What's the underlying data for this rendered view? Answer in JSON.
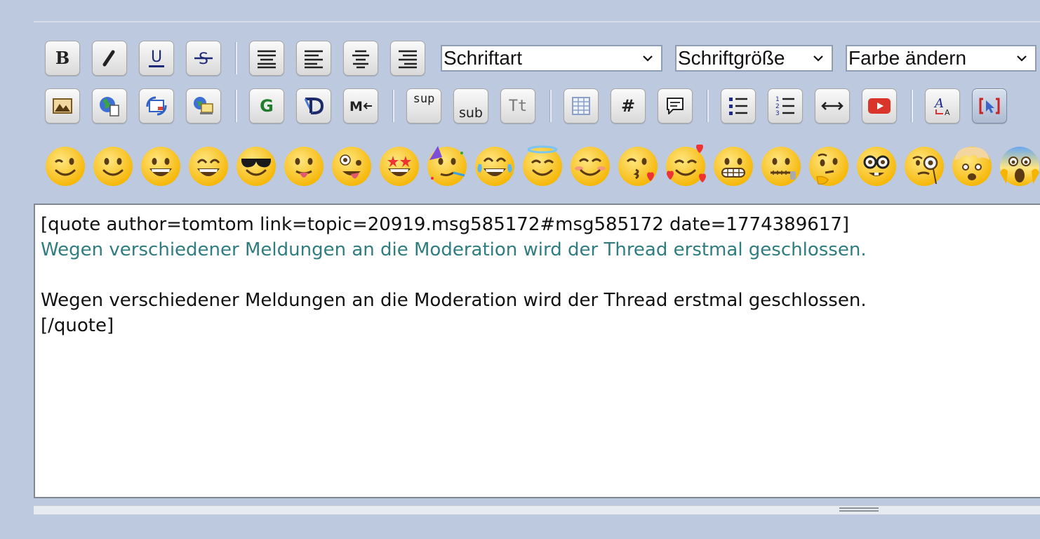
{
  "toolbar": {
    "row1": [
      {
        "name": "bold-button",
        "icon": "bold-icon"
      },
      {
        "name": "italic-button",
        "icon": "italic-icon"
      },
      {
        "name": "underline-button",
        "icon": "underline-icon"
      },
      {
        "name": "strikethrough-button",
        "icon": "strikethrough-icon"
      },
      {
        "name": "align-justify-button",
        "icon": "align-justify-icon"
      },
      {
        "name": "align-left-button",
        "icon": "align-left-icon"
      },
      {
        "name": "align-center-button",
        "icon": "align-center-icon"
      },
      {
        "name": "align-right-button",
        "icon": "align-right-icon"
      }
    ],
    "row2": [
      {
        "name": "insert-image-button",
        "icon": "image-icon"
      },
      {
        "name": "insert-link-button",
        "icon": "globe-link-icon"
      },
      {
        "name": "insert-email-button",
        "icon": "email-icon"
      },
      {
        "name": "insert-ftp-button",
        "icon": "ftp-icon"
      },
      {
        "name": "google-button",
        "icon": "google-icon"
      },
      {
        "name": "dict-button",
        "icon": "dict-icon"
      },
      {
        "name": "move-button",
        "icon": "move-icon"
      },
      {
        "name": "superscript-button",
        "icon": "superscript-icon"
      },
      {
        "name": "subscript-button",
        "icon": "subscript-icon"
      },
      {
        "name": "teletype-button",
        "icon": "teletype-icon"
      },
      {
        "name": "insert-table-button",
        "icon": "table-icon"
      },
      {
        "name": "insert-code-button",
        "icon": "code-hash-icon"
      },
      {
        "name": "insert-quote-button",
        "icon": "quote-icon"
      },
      {
        "name": "bullet-list-button",
        "icon": "bullet-list-icon"
      },
      {
        "name": "ordered-list-button",
        "icon": "ordered-list-icon"
      },
      {
        "name": "horizontal-rule-button",
        "icon": "horizontal-rule-icon"
      },
      {
        "name": "youtube-button",
        "icon": "youtube-icon"
      },
      {
        "name": "remove-format-button",
        "icon": "remove-format-icon"
      },
      {
        "name": "toggle-view-button",
        "icon": "toggle-view-icon"
      }
    ],
    "labels": {
      "bold": "B",
      "underline": "U",
      "google": "G",
      "sup": "sup",
      "sub": "sub",
      "tt": "Tt",
      "hash": "#"
    }
  },
  "selects": {
    "font_face": "Schriftart",
    "font_size": "Schriftgröße",
    "font_color": "Farbe ändern"
  },
  "emojis": [
    "winking-face",
    "slightly-smiling-face",
    "grinning-face",
    "beaming-face",
    "sunglasses-face",
    "tongue-out-face",
    "zany-face",
    "star-struck-face",
    "partying-face",
    "tears-of-joy-face",
    "halo-face",
    "smiling-blush-face",
    "kissing-heart-face",
    "hearts-face",
    "grimacing-face",
    "zipper-mouth-face",
    "thinking-face",
    "nerd-face",
    "monocle-face",
    "exploding-head-face",
    "screaming-face"
  ],
  "editor": {
    "line1": "[quote author=tomtom link=topic=20919.msg585172#msg585172 date=1774389617]",
    "line2": "Wegen verschiedener Meldungen an die Moderation wird der Thread erstmal geschlossen.",
    "line3": "",
    "line4": "Wegen verschiedener Meldungen an die Moderation wird der Thread erstmal geschlossen.",
    "line5": "[/quote]"
  },
  "colors": {
    "quote_text": "#2f7d7f",
    "background": "#bdc9de"
  }
}
